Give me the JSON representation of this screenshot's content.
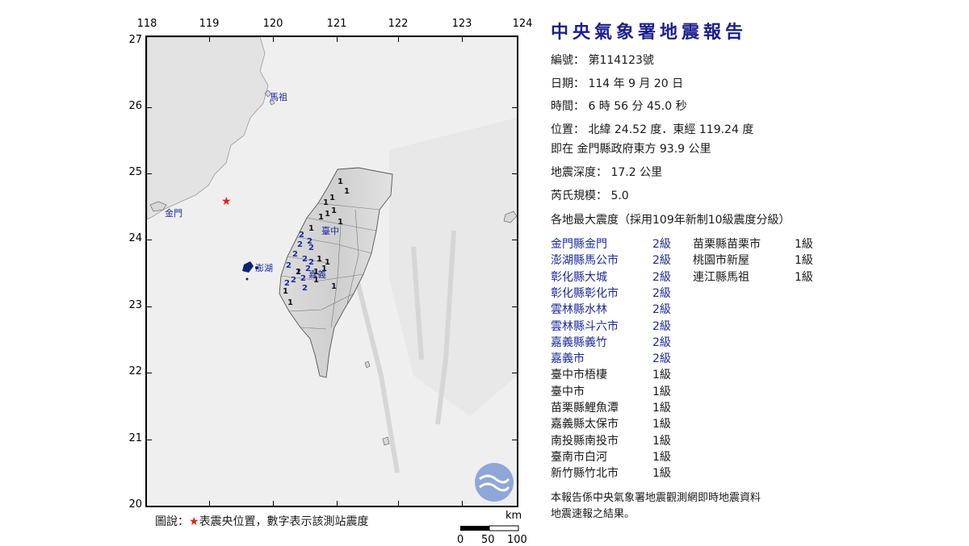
{
  "map": {
    "lon_ticks": [
      "118",
      "119",
      "120",
      "121",
      "122",
      "123",
      "124"
    ],
    "lat_ticks": [
      "27",
      "26",
      "25",
      "24",
      "23",
      "22",
      "21",
      "20"
    ],
    "place_labels": {
      "matsu": "馬祖",
      "kinmen": "金門",
      "taichung": "臺中",
      "penghu": "澎湖",
      "chiayi": "嘉義"
    },
    "epicenter_symbol": "★",
    "station_values": [
      "1",
      "1",
      "1",
      "1",
      "1",
      "1",
      "1",
      "1",
      "1",
      "2",
      "2",
      "2",
      "2",
      "2",
      "2",
      "2",
      "2",
      "2",
      "2",
      "2",
      "2",
      "2",
      "1",
      "1",
      "1",
      "1",
      "2",
      "1",
      "1",
      "1",
      "1",
      "1"
    ],
    "legend": {
      "prefix": "圖說：",
      "star": "★",
      "text": "表震央位置，數字表示該測站震度"
    },
    "scale": {
      "unit": "km",
      "labels": [
        "0",
        "50",
        "100"
      ]
    },
    "colors": {
      "epicenter": "#e0201b",
      "station_text": "#1b2b9f",
      "water": "#efefef",
      "land": "#e4e4e4"
    }
  },
  "report": {
    "title": "中央氣象署地震報告",
    "number": "編號： 第114123號",
    "date": "日期： 114 年 9 月 20 日",
    "time": "時間： 6 時 56 分 45.0 秒",
    "location": "位置： 北緯 24.52 度．東經 119.24 度",
    "relative": "即在 金門縣政府東方 93.9 公里",
    "depth": "地震深度： 17.2 公里",
    "magnitude": "芮氏規模： 5.0",
    "intensity_header": "各地最大震度（採用109年新制10級震度分級）",
    "intensity_left": [
      {
        "loc": "金門縣金門",
        "lvl": "2級",
        "color": "blue"
      },
      {
        "loc": "澎湖縣馬公市",
        "lvl": "2級",
        "color": "blue"
      },
      {
        "loc": "彰化縣大城",
        "lvl": "2級",
        "color": "blue"
      },
      {
        "loc": "彰化縣彰化市",
        "lvl": "2級",
        "color": "blue"
      },
      {
        "loc": "雲林縣水林",
        "lvl": "2級",
        "color": "blue"
      },
      {
        "loc": "雲林縣斗六市",
        "lvl": "2級",
        "color": "blue"
      },
      {
        "loc": "嘉義縣義竹",
        "lvl": "2級",
        "color": "blue"
      },
      {
        "loc": "嘉義市",
        "lvl": "2級",
        "color": "blue"
      },
      {
        "loc": "臺中市梧棲",
        "lvl": "1級",
        "color": "black"
      },
      {
        "loc": "臺中市",
        "lvl": "1級",
        "color": "black"
      },
      {
        "loc": "苗栗縣鯉魚潭",
        "lvl": "1級",
        "color": "black"
      },
      {
        "loc": "嘉義縣太保市",
        "lvl": "1級",
        "color": "black"
      },
      {
        "loc": "南投縣南投市",
        "lvl": "1級",
        "color": "black"
      },
      {
        "loc": "臺南市白河",
        "lvl": "1級",
        "color": "black"
      },
      {
        "loc": "新竹縣竹北市",
        "lvl": "1級",
        "color": "black"
      }
    ],
    "intensity_right": [
      {
        "loc": "苗栗縣苗栗市",
        "lvl": "1級",
        "color": "black"
      },
      {
        "loc": "桃園市新屋",
        "lvl": "1級",
        "color": "black"
      },
      {
        "loc": "連江縣馬祖",
        "lvl": "1級",
        "color": "black"
      }
    ],
    "footnote_line1": "本報告係中央氣象署地震觀測網即時地震資料",
    "footnote_line2": "地震速報之結果。"
  }
}
